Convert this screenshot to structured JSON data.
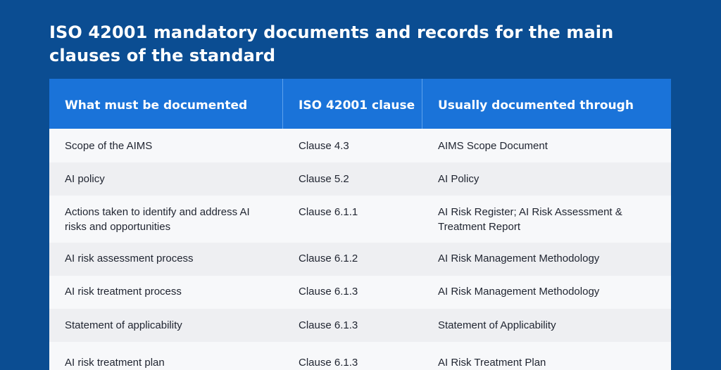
{
  "title": "ISO 42001 mandatory documents and records for the main clauses of the standard",
  "table": {
    "headers": [
      "What must be documented",
      "ISO 42001 clause",
      "Usually documented through"
    ],
    "rows": [
      {
        "documented": "Scope of the AIMS",
        "clause": "Clause 4.3",
        "through": "AIMS Scope Document"
      },
      {
        "documented": "AI policy",
        "clause": "Clause 5.2",
        "through": "AI Policy"
      },
      {
        "documented": "Actions taken to identify and address AI risks and opportunities",
        "clause": "Clause 6.1.1",
        "through": "AI Risk Register; AI Risk Assessment & Treatment Report"
      },
      {
        "documented": "AI risk assessment process",
        "clause": "Clause 6.1.2",
        "through": "AI Risk Management Methodology"
      },
      {
        "documented": "AI risk treatment process",
        "clause": "Clause 6.1.3",
        "through": "AI Risk Management Methodology"
      },
      {
        "documented": "Statement of applicability",
        "clause": "Clause 6.1.3",
        "through": "Statement of Applicability"
      },
      {
        "documented": "AI risk treatment plan",
        "clause": "Clause 6.1.3",
        "through": "AI Risk Treatment Plan"
      }
    ]
  },
  "colors": {
    "background": "#0b4d92",
    "header": "#1a73d9",
    "row_light": "#f7f8fa",
    "row_shade": "#eeeff2"
  }
}
